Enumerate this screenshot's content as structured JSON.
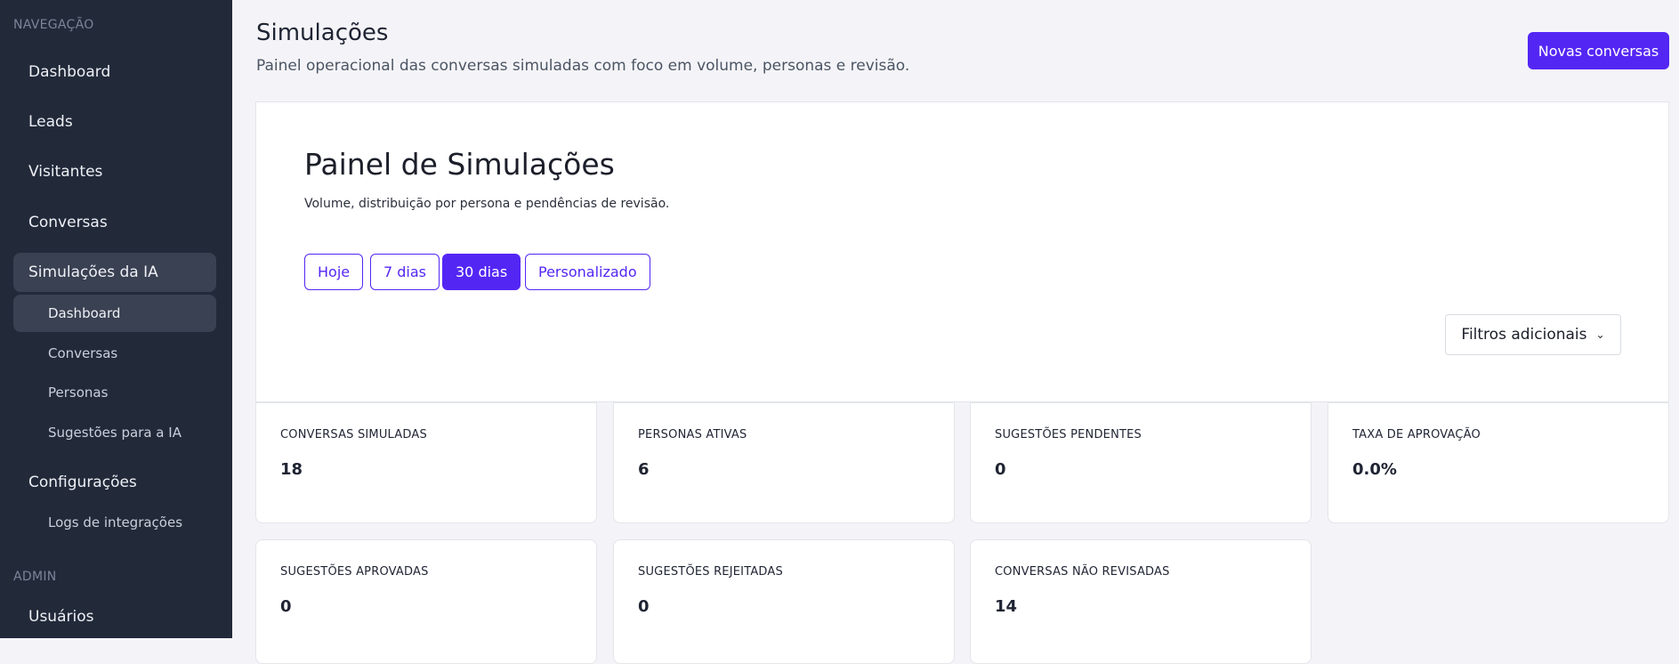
{
  "sidebar": {
    "sections": {
      "navigation": "NAVEGAÇÃO",
      "admin": "ADMIN"
    },
    "items": [
      {
        "label": "Dashboard"
      },
      {
        "label": "Leads"
      },
      {
        "label": "Visitantes"
      },
      {
        "label": "Conversas"
      },
      {
        "label": "Simulações da IA"
      },
      {
        "label": "Dashboard"
      },
      {
        "label": "Conversas"
      },
      {
        "label": "Personas"
      },
      {
        "label": "Sugestões para a IA"
      },
      {
        "label": "Configurações"
      },
      {
        "label": "Logs de integrações"
      },
      {
        "label": "Usuários"
      }
    ]
  },
  "header": {
    "title": "Simulações",
    "subtitle": "Painel operacional das conversas simuladas com foco em volume, personas e revisão.",
    "new_button": "Novas conversas"
  },
  "panel": {
    "title": "Painel de Simulações",
    "subtitle": "Volume, distribuição por persona e pendências de revisão.",
    "ranges": [
      "Hoje",
      "7 dias",
      "30 dias",
      "Personalizado"
    ],
    "selected_range": "30 dias",
    "filters_label": "Filtros adicionais"
  },
  "metrics": [
    {
      "label": "CONVERSAS SIMULADAS",
      "value": "18"
    },
    {
      "label": "PERSONAS ATIVAS",
      "value": "6"
    },
    {
      "label": "SUGESTÕES PENDENTES",
      "value": "0"
    },
    {
      "label": "TAXA DE APROVAÇÃO",
      "value": "0.0%"
    },
    {
      "label": "SUGESTÕES APROVADAS",
      "value": "0"
    },
    {
      "label": "SUGESTÕES REJEITADAS",
      "value": "0"
    },
    {
      "label": "CONVERSAS NÃO REVISADAS",
      "value": "14"
    }
  ],
  "colors": {
    "sidebar_bg": "#222a3a",
    "accent": "#5426f4",
    "page_bg": "#f4f4f8"
  },
  "icons": {
    "filters_chevron": "chevron-down-icon"
  }
}
